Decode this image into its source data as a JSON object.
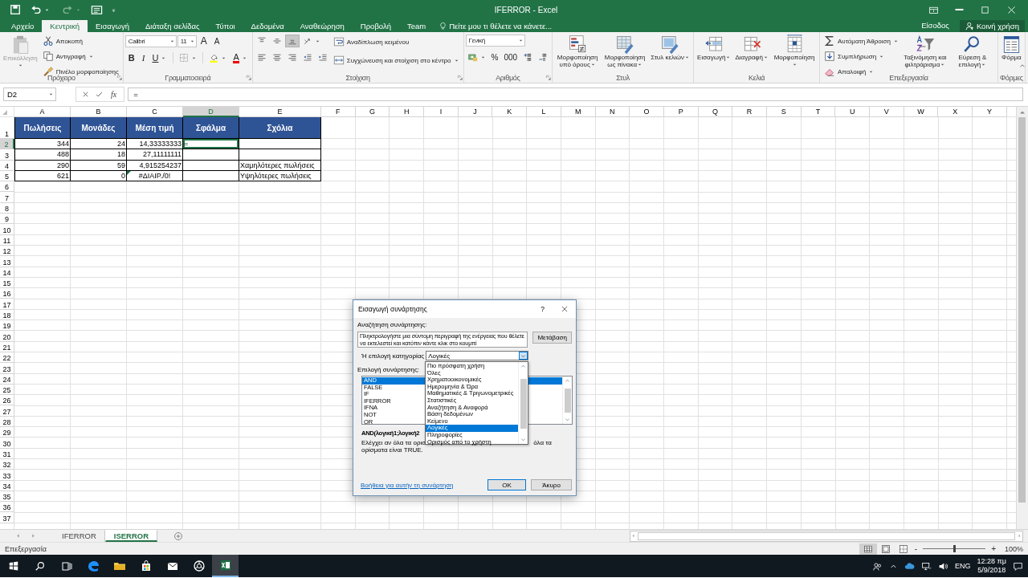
{
  "title_bar": {
    "title": "IFERROR - Excel"
  },
  "ribbon_tabs": [
    {
      "label": "Αρχείο",
      "selected": false
    },
    {
      "label": "Κεντρική",
      "selected": true
    },
    {
      "label": "Εισαγωγή",
      "selected": false
    },
    {
      "label": "Διάταξη σελίδας",
      "selected": false
    },
    {
      "label": "Τύποι",
      "selected": false
    },
    {
      "label": "Δεδομένα",
      "selected": false
    },
    {
      "label": "Αναθεώρηση",
      "selected": false
    },
    {
      "label": "Προβολή",
      "selected": false
    },
    {
      "label": "Team",
      "selected": false
    }
  ],
  "tell_me": {
    "placeholder": "Πείτε μου τι θέλετε να κάνετε..."
  },
  "account": {
    "sign_in": "Είσοδος",
    "share": "Κοινή χρήση"
  },
  "ribbon_groups": [
    {
      "kind": "clipboard",
      "label": "Πρόχειρο",
      "paste": {
        "label": "Επικόλληση",
        "disabled": true
      },
      "actions": [
        "Αποκοπή",
        "Αντιγραφή",
        "Πινέλο μορφοποίησης"
      ]
    },
    {
      "kind": "font",
      "label": "Γραμματοσειρά",
      "font": "Calibri",
      "size": "11",
      "grow": "A",
      "shrink": "A",
      "bold": "B",
      "italic": "I",
      "underline": "U",
      "font_color": "A"
    },
    {
      "kind": "alignment",
      "label": "Στοίχιση",
      "vertical": [
        {
          "selected": false
        },
        {
          "selected": false
        },
        {
          "selected": true
        }
      ],
      "wrap": "Αναδίπλωση κειμένου",
      "merge": "Συγχώνευση και στοίχιση στο κέντρο"
    },
    {
      "kind": "number",
      "label": "Αριθμός",
      "format": "Γενική",
      "percent": "%",
      "thousands": "000"
    },
    {
      "kind": "big",
      "label": "Στυλ",
      "buttons": [
        "Μορφοποίηση υπό όρους",
        "Μορφοποίηση ως πίνακα",
        "Στυλ κελιών"
      ]
    },
    {
      "kind": "big",
      "label": "Κελιά",
      "buttons": [
        "Εισαγωγή",
        "Διαγραφή",
        "Μορφοποίηση"
      ]
    },
    {
      "kind": "editing",
      "label": "Επεξεργασία",
      "actions": [
        "Αυτόματη Άθροιση",
        "Συμπλήρωση",
        "Απαλοιφή"
      ],
      "buttons": [
        "Ταξινόμηση και φιλτράρισμα",
        "Εύρεση & επιλογή"
      ]
    },
    {
      "kind": "big",
      "label": "Φόρμες",
      "buttons": [
        "Φόρμα"
      ]
    }
  ],
  "formula_bar": {
    "name_box": "D2",
    "function_button": "fx",
    "formula": "="
  },
  "sheet": {
    "columns": [
      {
        "label": "A",
        "selected": false
      },
      {
        "label": "B",
        "selected": false
      },
      {
        "label": "C",
        "selected": false
      },
      {
        "label": "D",
        "selected": true
      },
      {
        "label": "E",
        "selected": false
      },
      {
        "label": "F",
        "selected": false
      },
      {
        "label": "G",
        "selected": false
      },
      {
        "label": "H",
        "selected": false
      },
      {
        "label": "I",
        "selected": false
      },
      {
        "label": "J",
        "selected": false
      },
      {
        "label": "K",
        "selected": false
      },
      {
        "label": "L",
        "selected": false
      },
      {
        "label": "M",
        "selected": false
      },
      {
        "label": "N",
        "selected": false
      },
      {
        "label": "O",
        "selected": false
      },
      {
        "label": "P",
        "selected": false
      },
      {
        "label": "Q",
        "selected": false
      },
      {
        "label": "R",
        "selected": false
      },
      {
        "label": "S",
        "selected": false
      },
      {
        "label": "T",
        "selected": false
      },
      {
        "label": "U",
        "selected": false
      },
      {
        "label": "V",
        "selected": false
      },
      {
        "label": "W",
        "selected": false
      },
      {
        "label": "X",
        "selected": false
      },
      {
        "label": "Y",
        "selected": false
      }
    ],
    "rows": [
      {
        "label": "1",
        "selected": false,
        "cells": [
          {
            "kind": "header",
            "value": "Πωλήσεις"
          },
          {
            "kind": "header",
            "value": "Μονάδες"
          },
          {
            "kind": "header",
            "value": "Μέση τιμή"
          },
          {
            "kind": "header",
            "value": "Σφάλμα"
          },
          {
            "kind": "header",
            "value": "Σχόλια"
          }
        ]
      },
      {
        "label": "2",
        "selected": true,
        "cells": [
          {
            "kind": "number",
            "value": "344"
          },
          {
            "kind": "number",
            "value": "24"
          },
          {
            "kind": "number",
            "value": "14,33333333"
          },
          {
            "kind": "text",
            "value": "="
          },
          null
        ]
      },
      {
        "label": "3",
        "selected": false,
        "cells": [
          {
            "kind": "number",
            "value": "488"
          },
          {
            "kind": "number",
            "value": "18"
          },
          {
            "kind": "number",
            "value": "27,11111111"
          },
          null,
          null
        ]
      },
      {
        "label": "4",
        "selected": false,
        "cells": [
          {
            "kind": "number",
            "value": "290"
          },
          {
            "kind": "number",
            "value": "59"
          },
          {
            "kind": "number",
            "value": "4,915254237"
          },
          null,
          {
            "kind": "text",
            "value": "Χαμηλότερες πωλήσεις"
          }
        ]
      },
      {
        "label": "5",
        "selected": false,
        "cells": [
          {
            "kind": "number",
            "value": "621"
          },
          {
            "kind": "number",
            "value": "0"
          },
          {
            "kind": "error",
            "value": "#ΔΙΑΙΡ./0!"
          },
          null,
          {
            "kind": "text",
            "value": "Υψηλότερες πωλήσεις"
          }
        ]
      },
      {
        "label": "6",
        "selected": false
      },
      {
        "label": "7",
        "selected": false
      },
      {
        "label": "8",
        "selected": false
      },
      {
        "label": "9",
        "selected": false
      },
      {
        "label": "10",
        "selected": false
      },
      {
        "label": "11",
        "selected": false
      },
      {
        "label": "12",
        "selected": false
      },
      {
        "label": "13",
        "selected": false
      },
      {
        "label": "14",
        "selected": false
      },
      {
        "label": "15",
        "selected": false
      },
      {
        "label": "16",
        "selected": false
      },
      {
        "label": "17",
        "selected": false
      },
      {
        "label": "18",
        "selected": false
      },
      {
        "label": "19",
        "selected": false
      },
      {
        "label": "20",
        "selected": false
      },
      {
        "label": "21",
        "selected": false
      },
      {
        "label": "22",
        "selected": false
      },
      {
        "label": "23",
        "selected": false
      },
      {
        "label": "24",
        "selected": false
      },
      {
        "label": "25",
        "selected": false
      },
      {
        "label": "26",
        "selected": false
      },
      {
        "label": "27",
        "selected": false
      },
      {
        "label": "28",
        "selected": false
      },
      {
        "label": "29",
        "selected": false
      },
      {
        "label": "30",
        "selected": false
      },
      {
        "label": "31",
        "selected": false
      },
      {
        "label": "32",
        "selected": false
      },
      {
        "label": "33",
        "selected": false
      },
      {
        "label": "34",
        "selected": false
      },
      {
        "label": "35",
        "selected": false
      },
      {
        "label": "36",
        "selected": false
      },
      {
        "label": "37",
        "selected": false
      }
    ]
  },
  "sheet_tabs": [
    {
      "label": "IFERROR",
      "selected": false
    },
    {
      "label": "ISERROR",
      "selected": true
    }
  ],
  "status_bar": {
    "mode": "Επεξεργασία",
    "views": [
      {
        "selected": true
      },
      {
        "selected": false
      },
      {
        "selected": false
      }
    ],
    "zoom": {
      "minus": "-",
      "plus": "+",
      "level": 0.5,
      "reading": "100%"
    }
  },
  "taskbar": {
    "apps": [
      {
        "active": false
      },
      {
        "active": false
      },
      {
        "active": false
      },
      {
        "active": false
      },
      {
        "active": false
      },
      {
        "active": false
      },
      {
        "active": true
      }
    ],
    "language": "ENG",
    "time": "12:28 πμ",
    "date": "5/9/2018"
  },
  "dialog": {
    "title": "Εισαγωγή συνάρτησης",
    "help": "?",
    "search_label": "Αναζήτηση συνάρτησης:",
    "search_value": "Πληκτρολογήστε μια σύντομη περιγραφή της ενέργειας που θέλετε να εκτελεστεί και κατόπιν κάντε κλικ στο κουμπί",
    "go_button": "Μετάβαση",
    "category_label": "Ή επιλογή κατηγορίας",
    "category_value": "Λογικές",
    "category_options": [
      {
        "label": "Πιο πρόσφατη χρήση",
        "selected": false
      },
      {
        "label": "Όλες",
        "selected": false
      },
      {
        "label": "Χρηματοοικονομικές",
        "selected": false
      },
      {
        "label": "Ημερομηνία & Ώρα",
        "selected": false
      },
      {
        "label": "Μαθηματικές & Τριγωνομετρικές",
        "selected": false
      },
      {
        "label": "Στατιστικές",
        "selected": false
      },
      {
        "label": "Αναζήτηση & Αναφορά",
        "selected": false
      },
      {
        "label": "Βάση δεδομένων",
        "selected": false
      },
      {
        "label": "Κείμενο",
        "selected": false
      },
      {
        "label": "Λογικές",
        "selected": true
      },
      {
        "label": "Πληροφορίες",
        "selected": false
      },
      {
        "label": "Ορισμός από το χρήστη",
        "selected": false
      }
    ],
    "function_label": "Επιλογή συνάρτησης:",
    "functions": [
      {
        "label": "AND",
        "selected": true
      },
      {
        "label": "FALSE",
        "selected": false
      },
      {
        "label": "IF",
        "selected": false
      },
      {
        "label": "IFERROR",
        "selected": false
      },
      {
        "label": "IFNA",
        "selected": false
      },
      {
        "label": "NOT",
        "selected": false
      },
      {
        "label": "OR",
        "selected": false
      }
    ],
    "syntax": "AND(λογική1;λογική2",
    "description": [
      "Ελέγχει αν όλα τα ορισ",
      "όλα τα",
      "ορίσματα είναι TRUE."
    ],
    "help_link": "Βοήθεια για αυτήν τη συνάρτηση",
    "buttons": [
      "OK",
      "Άκυρο"
    ]
  }
}
